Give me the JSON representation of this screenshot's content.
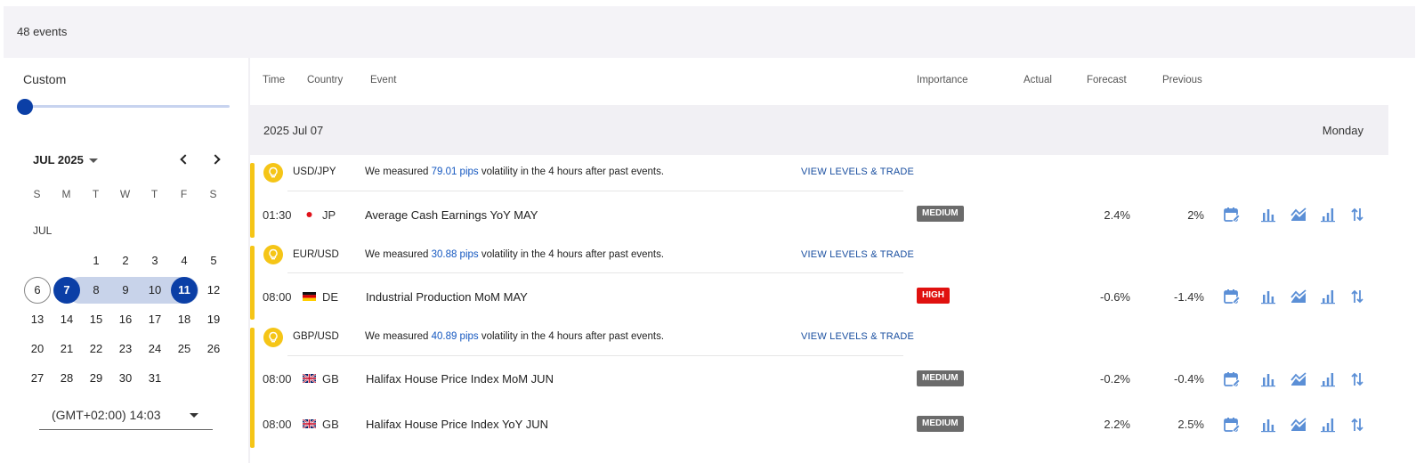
{
  "summary": {
    "events_count": "48 events"
  },
  "sidebar": {
    "range_label": "Custom",
    "calendar": {
      "month_label": "JUL 2025",
      "weekdays": [
        "S",
        "M",
        "T",
        "W",
        "T",
        "F",
        "S"
      ],
      "month_short": "JUL",
      "days": [
        "1",
        "2",
        "3",
        "4",
        "5",
        "6",
        "7",
        "8",
        "9",
        "10",
        "11",
        "12",
        "13",
        "14",
        "15",
        "16",
        "17",
        "18",
        "19",
        "20",
        "21",
        "22",
        "23",
        "24",
        "25",
        "26",
        "27",
        "28",
        "29",
        "30",
        "31"
      ],
      "today": "6",
      "selected_start": "7",
      "selected_end": "11"
    },
    "timezone": "(GMT+02:00) 14:03"
  },
  "table": {
    "columns": {
      "time": "Time",
      "country": "Country",
      "event": "Event",
      "importance": "Importance",
      "actual": "Actual",
      "forecast": "Forecast",
      "previous": "Previous"
    },
    "day_group": {
      "date": "2025 Jul 07",
      "weekday": "Monday"
    },
    "insights": [
      {
        "pair": "USD/JPY",
        "text_before": "We measured ",
        "pips": "79.01 pips",
        "text_after": " volatility in the 4 hours after past events.",
        "link": "VIEW LEVELS & TRADE"
      },
      {
        "pair": "EUR/USD",
        "text_before": "We measured ",
        "pips": "30.88 pips",
        "text_after": " volatility in the 4 hours after past events.",
        "link": "VIEW LEVELS & TRADE"
      },
      {
        "pair": "GBP/USD",
        "text_before": "We measured ",
        "pips": "40.89 pips",
        "text_after": " volatility in the 4 hours after past events.",
        "link": "VIEW LEVELS & TRADE"
      }
    ],
    "events": [
      {
        "time": "01:30",
        "country": "JP",
        "name": "Average Cash Earnings YoY MAY",
        "importance": "MEDIUM",
        "actual": "",
        "forecast": "2.4%",
        "previous": "2%"
      },
      {
        "time": "08:00",
        "country": "DE",
        "name": "Industrial Production MoM MAY",
        "importance": "HIGH",
        "actual": "",
        "forecast": "-0.6%",
        "previous": "-1.4%"
      },
      {
        "time": "08:00",
        "country": "GB",
        "name": "Halifax House Price Index MoM JUN",
        "importance": "MEDIUM",
        "actual": "",
        "forecast": "-0.2%",
        "previous": "-0.4%"
      },
      {
        "time": "08:00",
        "country": "GB",
        "name": "Halifax House Price Index YoY JUN",
        "importance": "MEDIUM",
        "actual": "",
        "forecast": "2.2%",
        "previous": "2.5%"
      }
    ],
    "action_icons": [
      "calendar-edit-icon",
      "bar-chart-icon",
      "volatility-chart-icon",
      "growth-chart-icon",
      "sort-arrows-icon"
    ]
  },
  "colors": {
    "accent_blue": "#0b3fa6",
    "range_band": "#c8d3ea",
    "insight_yellow": "#f5c517",
    "badge_medium": "#6b6b6b",
    "badge_high": "#e0110f",
    "link_blue": "#1a4fa0",
    "icon_blue": "#5b8fd6"
  }
}
